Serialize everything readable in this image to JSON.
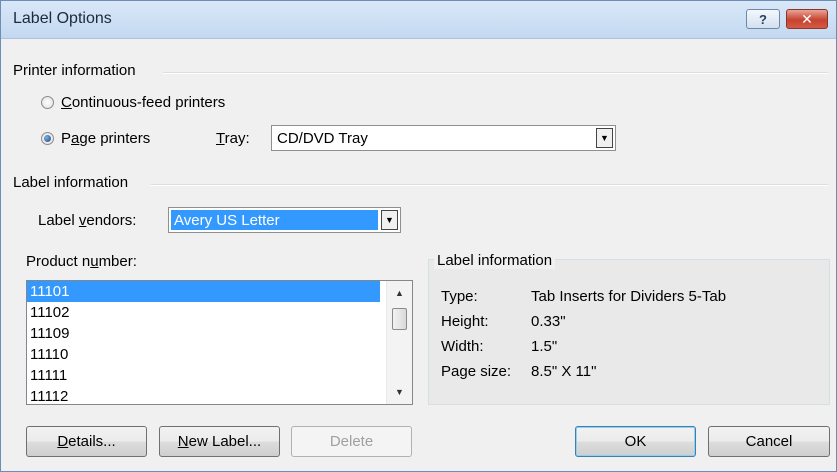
{
  "window": {
    "title": "Label Options",
    "help_symbol": "?",
    "close_symbol": "✕"
  },
  "printer_info": {
    "header": "Printer information",
    "continuous": {
      "pre": "",
      "acc": "C",
      "post": "ontinuous-feed printers",
      "checked": false
    },
    "page": {
      "pre": "P",
      "acc": "a",
      "post": "ge printers",
      "checked": true
    },
    "tray_label": {
      "acc": "T",
      "post": "ray:"
    },
    "tray_value": "CD/DVD Tray"
  },
  "label_info": {
    "header": "Label information",
    "vendors_label": {
      "pre": "Label ",
      "acc": "v",
      "post": "endors:"
    },
    "vendors_value": "Avery US Letter"
  },
  "product": {
    "label": {
      "pre": "Product n",
      "acc": "u",
      "post": "mber:"
    },
    "items": [
      "11101",
      "11102",
      "11109",
      "11110",
      "11111",
      "11112"
    ],
    "selected_index": 0
  },
  "details": {
    "title": "Label information",
    "rows": [
      {
        "key": "Type:",
        "value": "Tab Inserts for Dividers 5-Tab"
      },
      {
        "key": "Height:",
        "value": "0.33\""
      },
      {
        "key": "Width:",
        "value": "1.5\""
      },
      {
        "key": "Page size:",
        "value": "8.5\" X 11\""
      }
    ]
  },
  "buttons": {
    "details": {
      "acc": "D",
      "post": "etails..."
    },
    "new_label": {
      "acc": "N",
      "post": "ew Label..."
    },
    "delete": "Delete",
    "ok": "OK",
    "cancel": "Cancel"
  },
  "colors": {
    "selection": "#3399ff",
    "dialog_bg": "#f0f0f0",
    "title_bg": "#c3d8f0"
  }
}
